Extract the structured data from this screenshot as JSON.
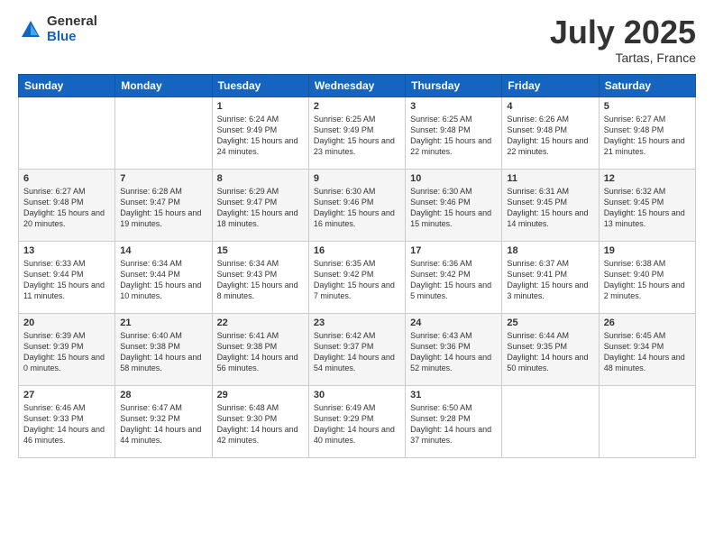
{
  "logo": {
    "general": "General",
    "blue": "Blue"
  },
  "title": "July 2025",
  "location": "Tartas, France",
  "days_header": [
    "Sunday",
    "Monday",
    "Tuesday",
    "Wednesday",
    "Thursday",
    "Friday",
    "Saturday"
  ],
  "weeks": [
    [
      {
        "day": "",
        "sunrise": "",
        "sunset": "",
        "daylight": ""
      },
      {
        "day": "",
        "sunrise": "",
        "sunset": "",
        "daylight": ""
      },
      {
        "day": "1",
        "sunrise": "Sunrise: 6:24 AM",
        "sunset": "Sunset: 9:49 PM",
        "daylight": "Daylight: 15 hours and 24 minutes."
      },
      {
        "day": "2",
        "sunrise": "Sunrise: 6:25 AM",
        "sunset": "Sunset: 9:49 PM",
        "daylight": "Daylight: 15 hours and 23 minutes."
      },
      {
        "day": "3",
        "sunrise": "Sunrise: 6:25 AM",
        "sunset": "Sunset: 9:48 PM",
        "daylight": "Daylight: 15 hours and 22 minutes."
      },
      {
        "day": "4",
        "sunrise": "Sunrise: 6:26 AM",
        "sunset": "Sunset: 9:48 PM",
        "daylight": "Daylight: 15 hours and 22 minutes."
      },
      {
        "day": "5",
        "sunrise": "Sunrise: 6:27 AM",
        "sunset": "Sunset: 9:48 PM",
        "daylight": "Daylight: 15 hours and 21 minutes."
      }
    ],
    [
      {
        "day": "6",
        "sunrise": "Sunrise: 6:27 AM",
        "sunset": "Sunset: 9:48 PM",
        "daylight": "Daylight: 15 hours and 20 minutes."
      },
      {
        "day": "7",
        "sunrise": "Sunrise: 6:28 AM",
        "sunset": "Sunset: 9:47 PM",
        "daylight": "Daylight: 15 hours and 19 minutes."
      },
      {
        "day": "8",
        "sunrise": "Sunrise: 6:29 AM",
        "sunset": "Sunset: 9:47 PM",
        "daylight": "Daylight: 15 hours and 18 minutes."
      },
      {
        "day": "9",
        "sunrise": "Sunrise: 6:30 AM",
        "sunset": "Sunset: 9:46 PM",
        "daylight": "Daylight: 15 hours and 16 minutes."
      },
      {
        "day": "10",
        "sunrise": "Sunrise: 6:30 AM",
        "sunset": "Sunset: 9:46 PM",
        "daylight": "Daylight: 15 hours and 15 minutes."
      },
      {
        "day": "11",
        "sunrise": "Sunrise: 6:31 AM",
        "sunset": "Sunset: 9:45 PM",
        "daylight": "Daylight: 15 hours and 14 minutes."
      },
      {
        "day": "12",
        "sunrise": "Sunrise: 6:32 AM",
        "sunset": "Sunset: 9:45 PM",
        "daylight": "Daylight: 15 hours and 13 minutes."
      }
    ],
    [
      {
        "day": "13",
        "sunrise": "Sunrise: 6:33 AM",
        "sunset": "Sunset: 9:44 PM",
        "daylight": "Daylight: 15 hours and 11 minutes."
      },
      {
        "day": "14",
        "sunrise": "Sunrise: 6:34 AM",
        "sunset": "Sunset: 9:44 PM",
        "daylight": "Daylight: 15 hours and 10 minutes."
      },
      {
        "day": "15",
        "sunrise": "Sunrise: 6:34 AM",
        "sunset": "Sunset: 9:43 PM",
        "daylight": "Daylight: 15 hours and 8 minutes."
      },
      {
        "day": "16",
        "sunrise": "Sunrise: 6:35 AM",
        "sunset": "Sunset: 9:42 PM",
        "daylight": "Daylight: 15 hours and 7 minutes."
      },
      {
        "day": "17",
        "sunrise": "Sunrise: 6:36 AM",
        "sunset": "Sunset: 9:42 PM",
        "daylight": "Daylight: 15 hours and 5 minutes."
      },
      {
        "day": "18",
        "sunrise": "Sunrise: 6:37 AM",
        "sunset": "Sunset: 9:41 PM",
        "daylight": "Daylight: 15 hours and 3 minutes."
      },
      {
        "day": "19",
        "sunrise": "Sunrise: 6:38 AM",
        "sunset": "Sunset: 9:40 PM",
        "daylight": "Daylight: 15 hours and 2 minutes."
      }
    ],
    [
      {
        "day": "20",
        "sunrise": "Sunrise: 6:39 AM",
        "sunset": "Sunset: 9:39 PM",
        "daylight": "Daylight: 15 hours and 0 minutes."
      },
      {
        "day": "21",
        "sunrise": "Sunrise: 6:40 AM",
        "sunset": "Sunset: 9:38 PM",
        "daylight": "Daylight: 14 hours and 58 minutes."
      },
      {
        "day": "22",
        "sunrise": "Sunrise: 6:41 AM",
        "sunset": "Sunset: 9:38 PM",
        "daylight": "Daylight: 14 hours and 56 minutes."
      },
      {
        "day": "23",
        "sunrise": "Sunrise: 6:42 AM",
        "sunset": "Sunset: 9:37 PM",
        "daylight": "Daylight: 14 hours and 54 minutes."
      },
      {
        "day": "24",
        "sunrise": "Sunrise: 6:43 AM",
        "sunset": "Sunset: 9:36 PM",
        "daylight": "Daylight: 14 hours and 52 minutes."
      },
      {
        "day": "25",
        "sunrise": "Sunrise: 6:44 AM",
        "sunset": "Sunset: 9:35 PM",
        "daylight": "Daylight: 14 hours and 50 minutes."
      },
      {
        "day": "26",
        "sunrise": "Sunrise: 6:45 AM",
        "sunset": "Sunset: 9:34 PM",
        "daylight": "Daylight: 14 hours and 48 minutes."
      }
    ],
    [
      {
        "day": "27",
        "sunrise": "Sunrise: 6:46 AM",
        "sunset": "Sunset: 9:33 PM",
        "daylight": "Daylight: 14 hours and 46 minutes."
      },
      {
        "day": "28",
        "sunrise": "Sunrise: 6:47 AM",
        "sunset": "Sunset: 9:32 PM",
        "daylight": "Daylight: 14 hours and 44 minutes."
      },
      {
        "day": "29",
        "sunrise": "Sunrise: 6:48 AM",
        "sunset": "Sunset: 9:30 PM",
        "daylight": "Daylight: 14 hours and 42 minutes."
      },
      {
        "day": "30",
        "sunrise": "Sunrise: 6:49 AM",
        "sunset": "Sunset: 9:29 PM",
        "daylight": "Daylight: 14 hours and 40 minutes."
      },
      {
        "day": "31",
        "sunrise": "Sunrise: 6:50 AM",
        "sunset": "Sunset: 9:28 PM",
        "daylight": "Daylight: 14 hours and 37 minutes."
      },
      {
        "day": "",
        "sunrise": "",
        "sunset": "",
        "daylight": ""
      },
      {
        "day": "",
        "sunrise": "",
        "sunset": "",
        "daylight": ""
      }
    ]
  ]
}
